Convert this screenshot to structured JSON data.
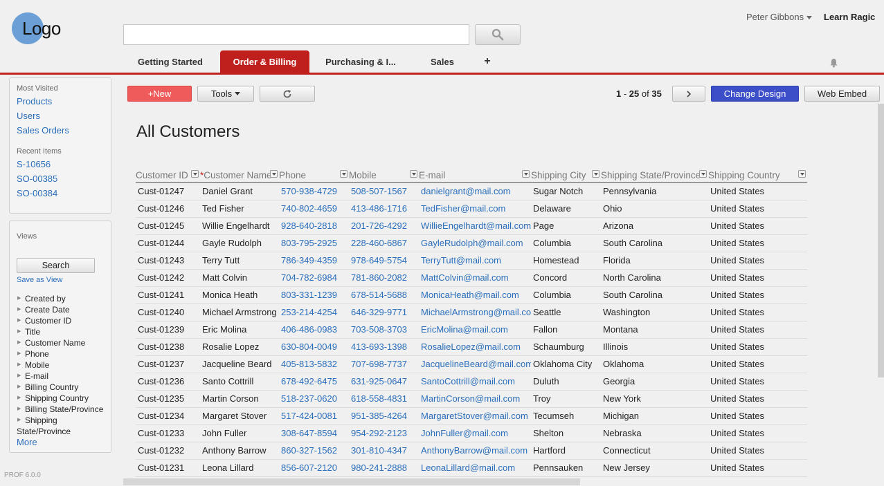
{
  "header": {
    "logo_text": "Logo",
    "search_value": "",
    "user_name": "Peter Gibbons",
    "learn_link": "Learn Ragic",
    "tabs": [
      {
        "label": "Getting Started"
      },
      {
        "label": "Order & Billing"
      },
      {
        "label": "Purchasing & I..."
      },
      {
        "label": "Sales"
      },
      {
        "label": "+"
      }
    ]
  },
  "sidebar": {
    "most_visited_label": "Most Visited",
    "most_visited": [
      "Products",
      "Users",
      "Sales Orders"
    ],
    "recent_label": "Recent Items",
    "recent": [
      "S-10656",
      "SO-00385",
      "SO-00384"
    ],
    "views_label": "Views",
    "search_button": "Search",
    "save_as_view": "Save as View",
    "fields": [
      "Created by",
      "Create Date",
      "Customer ID",
      "Title",
      "Customer Name",
      "Phone",
      "Mobile",
      "E-mail",
      "Billing Country",
      "Shipping Country",
      "Billing State/Province",
      "Shipping",
      "State/Province"
    ],
    "more": "More",
    "version": "PROF 6.0.0"
  },
  "toolbar": {
    "new_label": "+New",
    "tools_label": "Tools",
    "pager_start": "1",
    "pager_sep": " - ",
    "pager_end": "25",
    "pager_of": " of ",
    "pager_total": "35",
    "change_design": "Change Design",
    "web_embed": "Web Embed"
  },
  "page_title": "All Customers",
  "table": {
    "columns": [
      "Customer ID",
      "Customer Name",
      "Phone",
      "Mobile",
      "E-mail",
      "Shipping City",
      "Shipping State/Province",
      "Shipping Country"
    ],
    "required_mark": "*",
    "rows": [
      [
        "Cust-01247",
        "Daniel Grant",
        "570-938-4729",
        "508-507-1567",
        "danielgrant@mail.com",
        "Sugar Notch",
        "Pennsylvania",
        "United States"
      ],
      [
        "Cust-01246",
        "Ted Fisher",
        "740-802-4659",
        "413-486-1716",
        "TedFisher@mail.com",
        "Delaware",
        "Ohio",
        "United States"
      ],
      [
        "Cust-01245",
        "Willie Engelhardt",
        "928-640-2818",
        "201-726-4292",
        "WillieEngelhardt@mail.com",
        "Page",
        "Arizona",
        "United States"
      ],
      [
        "Cust-01244",
        "Gayle Rudolph",
        "803-795-2925",
        "228-460-6867",
        "GayleRudolph@mail.com",
        "Columbia",
        "South Carolina",
        "United States"
      ],
      [
        "Cust-01243",
        "Terry Tutt",
        "786-349-4359",
        "978-649-5754",
        "TerryTutt@mail.com",
        "Homestead",
        "Florida",
        "United States"
      ],
      [
        "Cust-01242",
        "Matt Colvin",
        "704-782-6984",
        "781-860-2082",
        "MattColvin@mail.com",
        "Concord",
        "North Carolina",
        "United States"
      ],
      [
        "Cust-01241",
        "Monica Heath",
        "803-331-1239",
        "678-514-5688",
        "MonicaHeath@mail.com",
        "Columbia",
        "South Carolina",
        "United States"
      ],
      [
        "Cust-01240",
        "Michael Armstrong",
        "253-214-4254",
        "646-329-9771",
        "MichaelArmstrong@mail.com",
        "Seattle",
        "Washington",
        "United States"
      ],
      [
        "Cust-01239",
        "Eric Molina",
        "406-486-0983",
        "703-508-3703",
        "EricMolina@mail.com",
        "Fallon",
        "Montana",
        "United States"
      ],
      [
        "Cust-01238",
        "Rosalie Lopez",
        "630-804-0049",
        "413-693-1398",
        "RosalieLopez@mail.com",
        "Schaumburg",
        "Illinois",
        "United States"
      ],
      [
        "Cust-01237",
        "Jacqueline Beard",
        "405-813-5832",
        "707-698-7737",
        "JacquelineBeard@mail.com",
        "Oklahoma City",
        "Oklahoma",
        "United States"
      ],
      [
        "Cust-01236",
        "Santo Cottrill",
        "678-492-6475",
        "631-925-0647",
        "SantoCottrill@mail.com",
        "Duluth",
        "Georgia",
        "United States"
      ],
      [
        "Cust-01235",
        "Martin Corson",
        "518-237-0620",
        "618-558-4831",
        "MartinCorson@mail.com",
        "Troy",
        "New York",
        "United States"
      ],
      [
        "Cust-01234",
        "Margaret Stover",
        "517-424-0081",
        "951-385-4264",
        "MargaretStover@mail.com",
        "Tecumseh",
        "Michigan",
        "United States"
      ],
      [
        "Cust-01233",
        "John Fuller",
        "308-647-8594",
        "954-292-2123",
        "JohnFuller@mail.com",
        "Shelton",
        "Nebraska",
        "United States"
      ],
      [
        "Cust-01232",
        "Anthony Barrow",
        "860-327-1562",
        "301-810-4347",
        "AnthonyBarrow@mail.com",
        "Hartford",
        "Connecticut",
        "United States"
      ],
      [
        "Cust-01231",
        "Leona Lillard",
        "856-607-2120",
        "980-241-2888",
        "LeonaLillard@mail.com",
        "Pennsauken",
        "New Jersey",
        "United States"
      ]
    ]
  },
  "colors": {
    "accent_red": "#c0201d",
    "link_blue": "#2a6ebb",
    "design_button": "#3d4fc8",
    "new_button": "#ef5a5a"
  },
  "icons": {
    "search": "magnifier-icon",
    "refresh": "refresh-icon",
    "next": "chevron-right-icon",
    "bell": "bell-icon"
  }
}
